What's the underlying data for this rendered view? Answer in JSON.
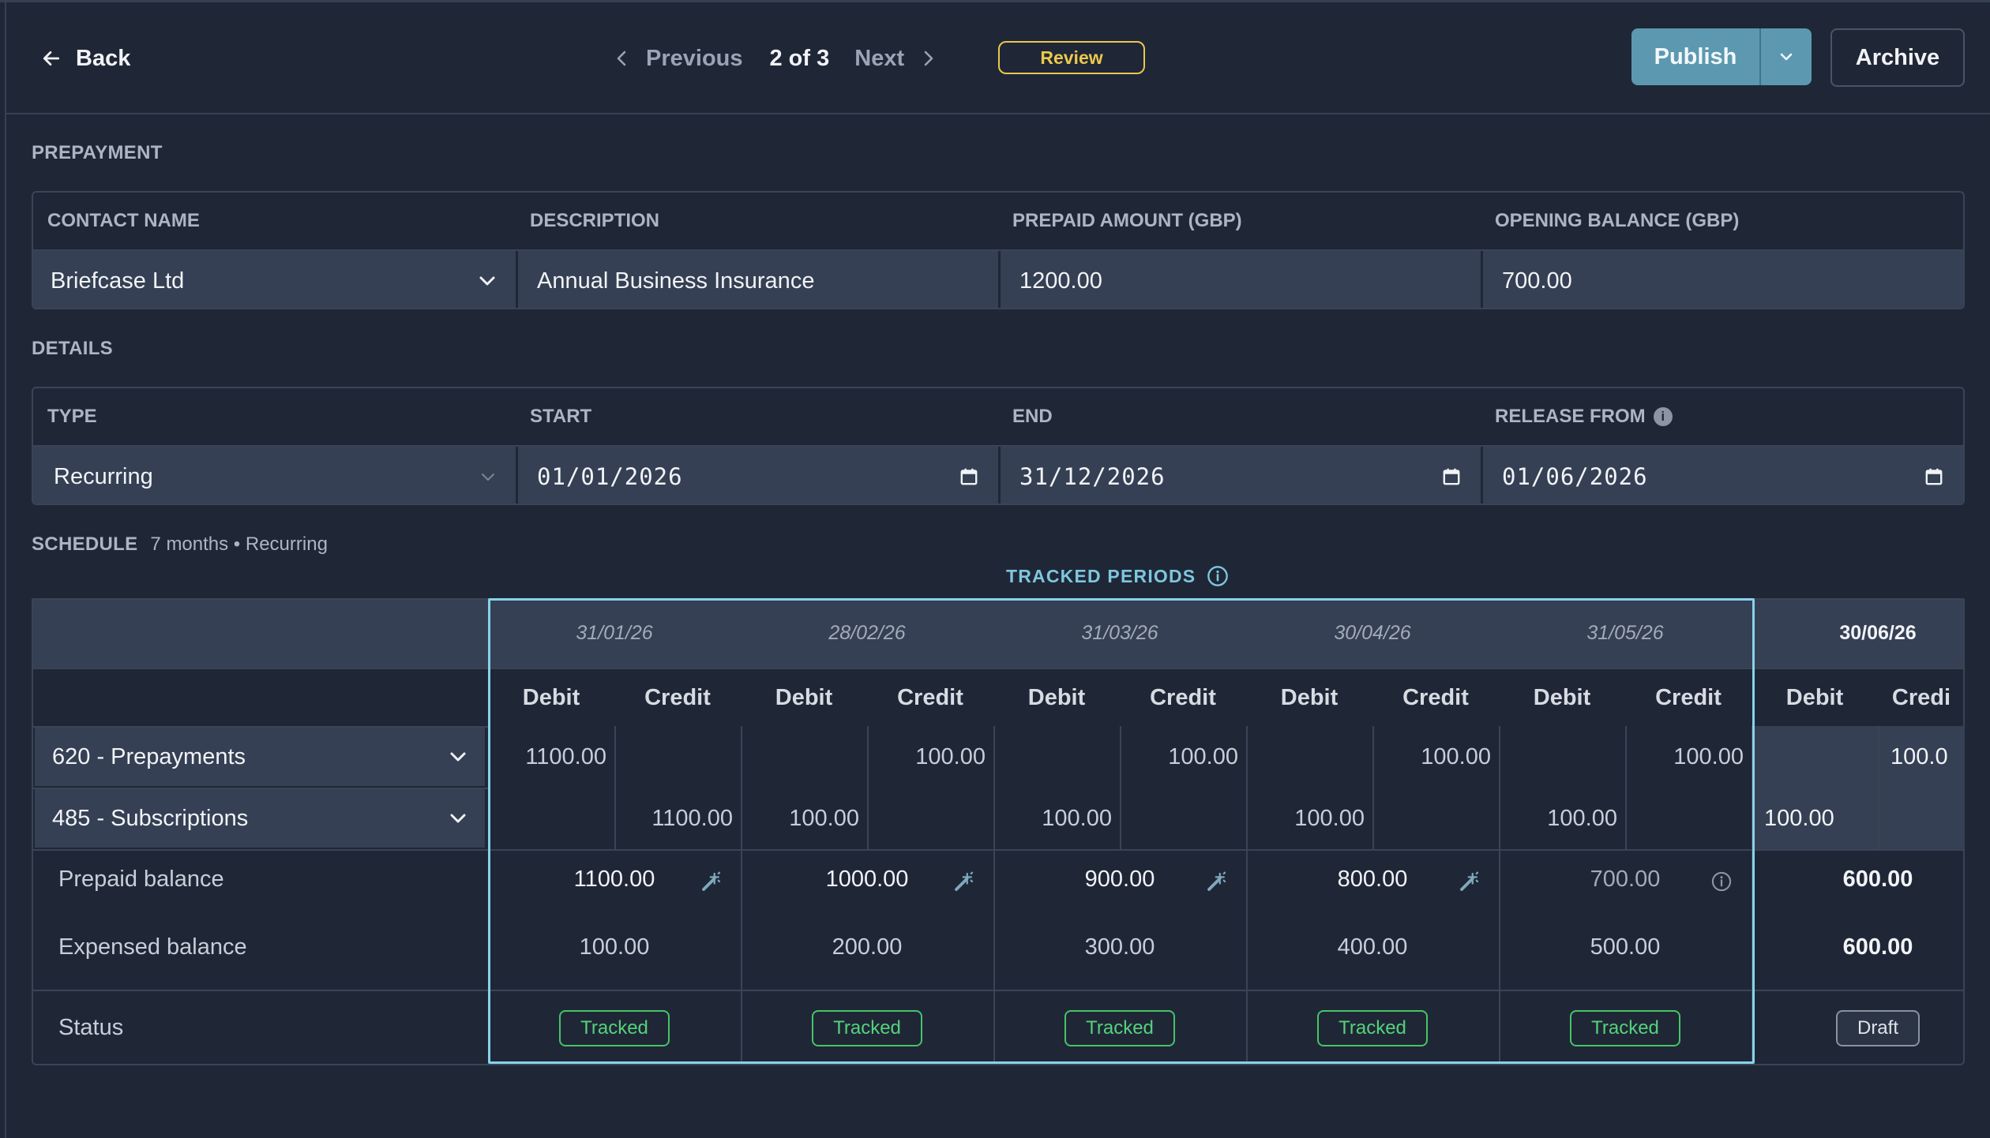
{
  "header": {
    "back_label": "Back",
    "previous_label": "Previous",
    "page_indicator": "2 of 3",
    "next_label": "Next",
    "status_badge": "Review",
    "publish_label": "Publish",
    "archive_label": "Archive"
  },
  "prepayment": {
    "section_title": "PREPAYMENT",
    "labels": {
      "contact": "CONTACT NAME",
      "description": "DESCRIPTION",
      "amount": "PREPAID AMOUNT (GBP)",
      "opening": "OPENING BALANCE (GBP)"
    },
    "values": {
      "contact": "Briefcase Ltd",
      "description": "Annual Business Insurance",
      "amount": "1200.00",
      "opening": "700.00"
    }
  },
  "details": {
    "section_title": "DETAILS",
    "labels": {
      "type": "TYPE",
      "start": "START",
      "end": "END",
      "release": "RELEASE FROM"
    },
    "values": {
      "type": "Recurring",
      "start": "01/01/2026",
      "end": "31/12/2026",
      "release": "01/06/2026"
    }
  },
  "schedule": {
    "section_title": "SCHEDULE",
    "meta": "7 months • Recurring",
    "tracked_periods_label": "TRACKED PERIODS",
    "dates": [
      "31/01/26",
      "28/02/26",
      "31/03/26",
      "30/04/26",
      "31/05/26",
      "30/06/26"
    ],
    "debit_label": "Debit",
    "credit_label": "Credit",
    "credit_label_partial": "Credi",
    "accounts": [
      {
        "name": "620 - Prepayments",
        "cells": [
          "1100.00",
          "",
          "",
          "100.00",
          "",
          "100.00",
          "",
          "100.00",
          "",
          "100.00",
          "",
          "100.0"
        ]
      },
      {
        "name": "485 - Subscriptions",
        "cells": [
          "",
          "1100.00",
          "100.00",
          "",
          "100.00",
          "",
          "100.00",
          "",
          "100.00",
          "",
          "100.00",
          ""
        ]
      }
    ],
    "prepaid_label": "Prepaid balance",
    "prepaid_values": [
      "1100.00",
      "1000.00",
      "900.00",
      "800.00",
      "700.00",
      "600.00"
    ],
    "expensed_label": "Expensed balance",
    "expensed_values": [
      "100.00",
      "200.00",
      "300.00",
      "400.00",
      "500.00",
      "600.00"
    ],
    "status_label": "Status",
    "statuses": [
      "Tracked",
      "Tracked",
      "Tracked",
      "Tracked",
      "Tracked",
      "Draft"
    ]
  },
  "colors": {
    "background": "#1f2737",
    "field": "#354054",
    "accent": "#5c99b0",
    "tracked": "#46c466",
    "review": "#e9c84a",
    "highlight": "#86d3ea"
  }
}
